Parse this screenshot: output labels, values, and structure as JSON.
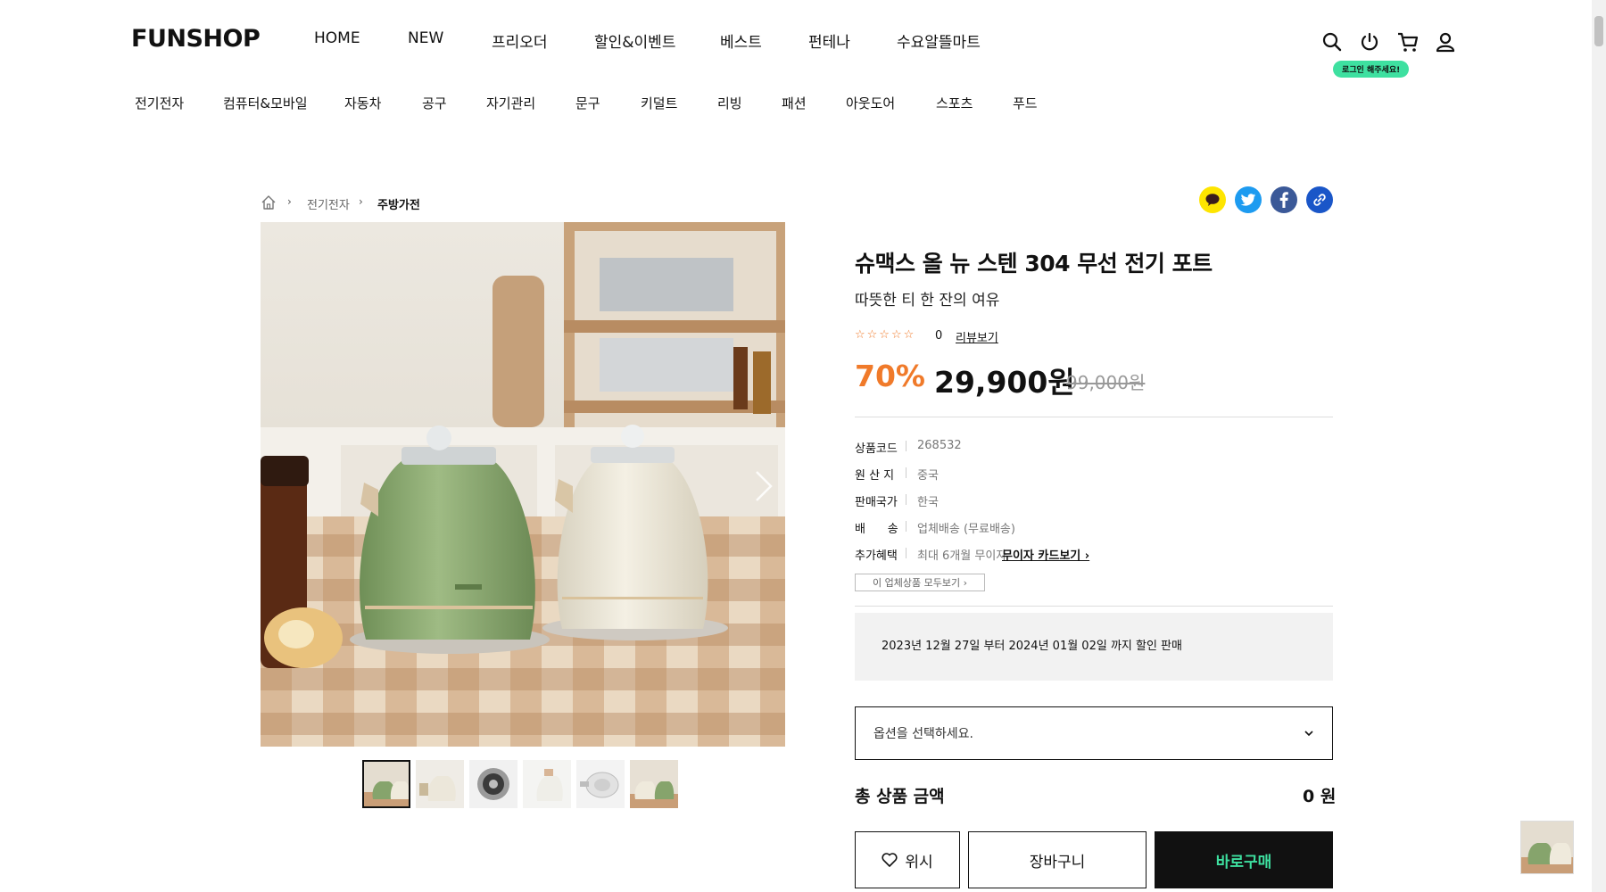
{
  "header": {
    "logo": "FUNSHOP",
    "nav": [
      "HOME",
      "NEW",
      "프리오더",
      "할인&이벤트",
      "베스트",
      "펀테나",
      "수요알뜰마트"
    ],
    "icons": [
      "search-icon",
      "power-icon",
      "cart-icon",
      "user-icon"
    ],
    "login_badge": "로그인 해주세요!"
  },
  "categories": [
    "전기전자",
    "컴퓨터&모바일",
    "자동차",
    "공구",
    "자기관리",
    "문구",
    "키덜트",
    "리빙",
    "패션",
    "아웃도어",
    "스포츠",
    "푸드"
  ],
  "breadcrumb": {
    "level1": "전기전자",
    "level2": "주방가전"
  },
  "share": [
    "kakaotalk-icon",
    "twitter-icon",
    "facebook-icon",
    "link-icon"
  ],
  "colors": {
    "accent_orange": "#f07a2a",
    "mint": "#3ee0a0",
    "kakao": "#fee500",
    "twitter": "#1d9bf0",
    "facebook": "#1877f2",
    "link": "#1a56c8"
  },
  "product": {
    "title": "슈맥스 올 뉴 스텐 304 무선 전기 포트",
    "subtitle": "따뜻한 티 한 잔의 여유",
    "stars": "☆☆☆☆☆",
    "review_count": "0",
    "review_link": "리뷰보기",
    "discount": "70%",
    "price": "29,900원",
    "original_price": "99,000원",
    "info": [
      {
        "label": "상품코드",
        "value": "268532"
      },
      {
        "label": "원 산 지",
        "value": "중국"
      },
      {
        "label": "판매국가",
        "value": "한국"
      },
      {
        "label": "배      송",
        "value": "업체배송 (무료배송)"
      },
      {
        "label": "추가혜택",
        "value": "최대 6개월 무이자",
        "link": "무이자 카드보기 ›"
      }
    ],
    "vendor_button": "이 업체상품 모두보기 ›",
    "sale_period": "2023년 12월 27일 부터 2024년 01월 02일 까지 할인 판매",
    "option_placeholder": "옵션을 선택하세요.",
    "total_label": "총 상품 금액",
    "total_value": "0 원",
    "wish_label": "위시",
    "cart_label": "장바구니",
    "buy_label": "바로구매"
  }
}
